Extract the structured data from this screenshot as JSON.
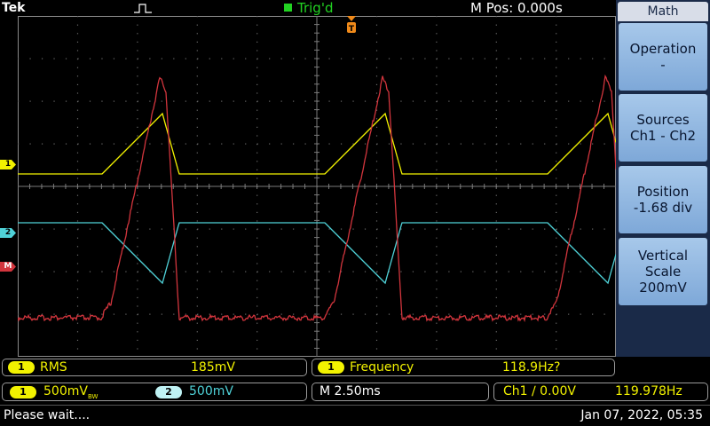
{
  "brand": "Tek",
  "trigger": {
    "status": "Trig'd",
    "status_color": "#22d222",
    "mode_icon": "single-pulse-icon"
  },
  "horizontal": {
    "position": "M Pos: 0.000s",
    "timebase": "M 2.50ms"
  },
  "side_menu": {
    "title": "Math",
    "buttons": [
      {
        "line1": "Operation",
        "line2": "-"
      },
      {
        "line1": "Sources",
        "line2": "Ch1 - Ch2"
      },
      {
        "line1": "Position",
        "line2": "-1.68 div"
      },
      {
        "line1": "Vertical",
        "line2": "Scale",
        "line3": "200mV"
      }
    ]
  },
  "channels": {
    "ch1": {
      "marker": "1",
      "color": "#f2f200",
      "scale": "500mV",
      "bw_suffix": "BW"
    },
    "ch2": {
      "marker": "2",
      "color": "#4fd2d8",
      "scale": "500mV"
    },
    "math": {
      "marker": "M",
      "color": "#d2353d"
    }
  },
  "measurements": [
    {
      "source": "1",
      "label": "RMS",
      "value": "185mV"
    },
    {
      "source": "1",
      "label": "Frequency",
      "value": "118.9Hz?"
    }
  ],
  "trigger_info": {
    "source": "Ch1 ∕ 0.00V",
    "frequency": "119.978Hz"
  },
  "status_message": "Please wait....",
  "datetime": "Jan 07, 2022, 05:35"
}
